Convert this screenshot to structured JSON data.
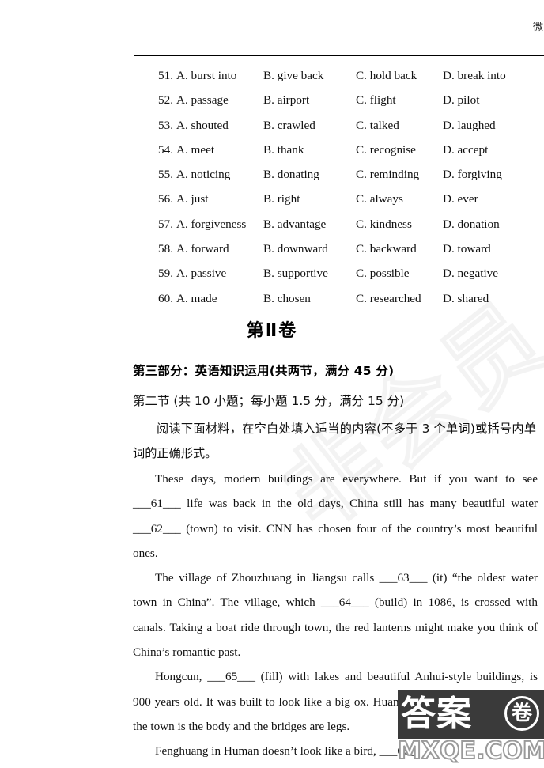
{
  "page": {
    "corner_mark": "微",
    "juan_heading": "第Ⅱ卷",
    "part_heading": "第三部分：英语知识运用(共两节，满分 45 分)",
    "section_line": "第二节 (共 10 小题；每小题 1.5 分，满分 15 分)",
    "instruction": "阅读下面材料，在空白处填入适当的内容(不多于 3 个单词)或括号内单词的正确形式。"
  },
  "cloze_options": {
    "columns": [
      "A",
      "B",
      "C",
      "D"
    ],
    "rows": [
      {
        "num": "51.",
        "a": "A. burst into",
        "b": "B. give back",
        "c": "C. hold back",
        "d": "D. break into"
      },
      {
        "num": "52.",
        "a": "A. passage",
        "b": "B. airport",
        "c": "C. flight",
        "d": "D. pilot"
      },
      {
        "num": "53.",
        "a": "A. shouted",
        "b": "B. crawled",
        "c": "C. talked",
        "d": "D. laughed"
      },
      {
        "num": "54.",
        "a": "A. meet",
        "b": "B. thank",
        "c": "C. recognise",
        "d": "D. accept"
      },
      {
        "num": "55.",
        "a": "A. noticing",
        "b": "B. donating",
        "c": "C. reminding",
        "d": "D. forgiving"
      },
      {
        "num": "56.",
        "a": "A. just",
        "b": "B. right",
        "c": "C. always",
        "d": "D. ever"
      },
      {
        "num": "57.",
        "a": "A. forgiveness",
        "b": "B. advantage",
        "c": "C. kindness",
        "d": "D. donation"
      },
      {
        "num": "58.",
        "a": "A. forward",
        "b": "B. downward",
        "c": "C. backward",
        "d": "D. toward"
      },
      {
        "num": "59.",
        "a": "A. passive",
        "b": "B. supportive",
        "c": "C. possible",
        "d": "D. negative"
      },
      {
        "num": "60.",
        "a": "A. made",
        "b": "B. chosen",
        "c": "C. researched",
        "d": "D. shared"
      }
    ]
  },
  "passage": {
    "paragraphs": [
      "These days, modern buildings are everywhere. But if you want to see ___61___ life was back in the old days, China still has many beautiful water ___62___ (town) to visit. CNN has chosen four of the country’s most beautiful ones.",
      "The village of Zhouzhuang in Jiangsu calls ___63___ (it) “the oldest water town in China”. The village, which ___64___ (build) in 1086, is crossed with canals. Taking a boat ride through town, the red lanterns might make you think of China’s romantic past.",
      "Hongcun, ___65___ (fill) with lakes and beautiful Anhui-style buildings, is 900 years old. It was built to look like a big ox. Huangshan Mountain is the head; the town is the body and the bridges are legs.",
      "Fenghuang in Human doesn’t look like a bird, ___66_"
    ]
  },
  "watermarks": {
    "diagonal_text": "非会员",
    "logo_cjk": "答案",
    "logo_circle_char": "卷",
    "logo_domain": "MXQE.COM"
  }
}
